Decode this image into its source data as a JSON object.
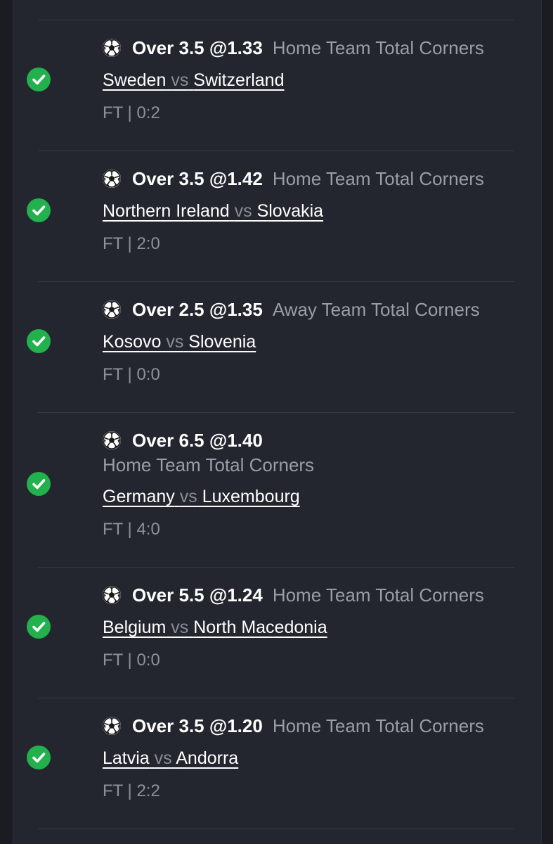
{
  "colors": {
    "background": "#1a1c21",
    "panel": "#23262e",
    "check": "#22b14c",
    "text": "#ffffff",
    "muted": "#9a9da6"
  },
  "icons": {
    "status": "check-circle-icon",
    "sport": "soccer-ball-icon"
  },
  "bets": [
    {
      "odds": "Over 3.5 @1.33",
      "market": "Home Team Total Corners",
      "home": "Sweden",
      "vs": "vs",
      "away": "Switzerland",
      "result": "FT | 0:2",
      "status": "won"
    },
    {
      "odds": "Over 3.5 @1.42",
      "market": "Home Team Total Corners",
      "home": "Northern Ireland",
      "vs": "vs",
      "away": "Slovakia",
      "result": "FT | 2:0",
      "status": "won"
    },
    {
      "odds": "Over 2.5 @1.35",
      "market": "Away Team Total Corners",
      "home": "Kosovo",
      "vs": "vs",
      "away": "Slovenia",
      "result": "FT | 0:0",
      "status": "won"
    },
    {
      "odds": "Over 6.5 @1.40",
      "market": "Home Team Total Corners",
      "home": "Germany",
      "vs": "vs",
      "away": "Luxembourg",
      "result": "FT | 4:0",
      "status": "won"
    },
    {
      "odds": "Over 5.5 @1.24",
      "market": "Home Team Total Corners",
      "home": "Belgium",
      "vs": "vs",
      "away": "North Macedonia",
      "result": "FT | 0:0",
      "status": "won"
    },
    {
      "odds": "Over 3.5 @1.20",
      "market": "Home Team Total Corners",
      "home": "Latvia",
      "vs": "vs",
      "away": "Andorra",
      "result": "FT | 2:2",
      "status": "won"
    }
  ]
}
